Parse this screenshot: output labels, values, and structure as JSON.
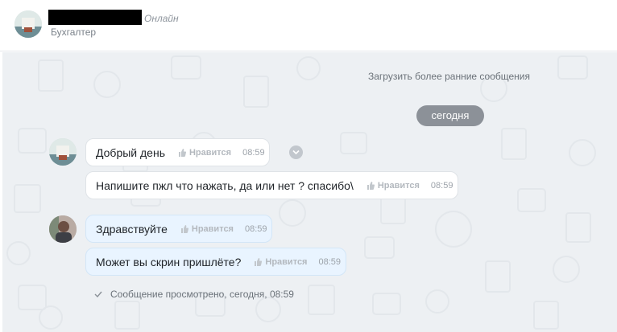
{
  "header": {
    "status": "Онлайн",
    "role": "Бухгалтер"
  },
  "chat": {
    "load_earlier": "Загрузить более ранние сообщения",
    "date_divider": "сегодня",
    "messages": [
      {
        "text": "Добрый день",
        "like_label": "Нравится",
        "time": "08:59"
      },
      {
        "text": "Напишите пжл что нажать, да или нет ? спасибо\\",
        "like_label": "Нравится",
        "time": "08:59"
      },
      {
        "text": "Здравствуйте",
        "like_label": "Нравится",
        "time": "08:59"
      },
      {
        "text": "Может вы скрин пришлёте?",
        "like_label": "Нравится",
        "time": "08:59"
      }
    ],
    "seen_status": "Сообщение просмотрено, сегодня, 08:59"
  },
  "colors": {
    "chat_background": "#edf0f3",
    "incoming_bubble": "#ffffff",
    "outgoing_bubble": "#e9f4ff",
    "date_pill": "#8c9198"
  },
  "icons": [
    "avatar-photo",
    "thumbs-up-icon",
    "chevron-down-icon",
    "check-icon"
  ]
}
